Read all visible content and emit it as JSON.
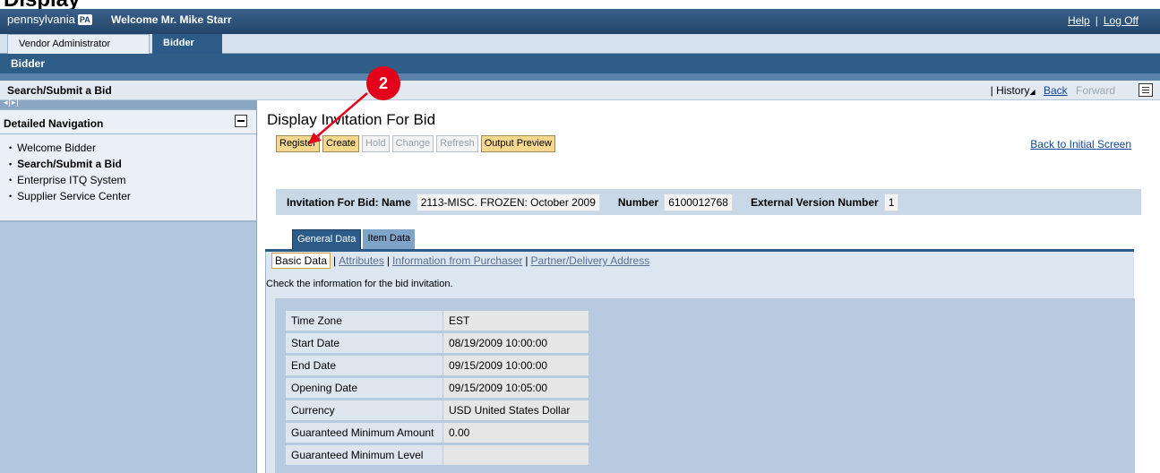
{
  "slide_title": "Display",
  "header": {
    "logo_text": "pennsylvania",
    "logo_badge": "PA",
    "welcome": "Welcome Mr. Mike Starr",
    "help_link": "Help",
    "logoff_link": "Log Off"
  },
  "tabs": {
    "vendor_admin": "Vendor Administrator",
    "bidder": "Bidder"
  },
  "subheader": "Bidder",
  "breadcrumb": {
    "current": "Search/Submit a Bid",
    "history_prefix": "| History",
    "back": "Back",
    "forward": "Forward"
  },
  "sidebar": {
    "title": "Detailed Navigation",
    "items": [
      {
        "label": "Welcome Bidder"
      },
      {
        "label": "Search/Submit a Bid"
      },
      {
        "label": "Enterprise ITQ System"
      },
      {
        "label": "Supplier Service Center"
      }
    ]
  },
  "main": {
    "title": "Display Invitation For Bid",
    "toolbar": {
      "register": "Register",
      "create": "Create",
      "hold": "Hold",
      "change": "Change",
      "refresh": "Refresh",
      "output_preview": "Output Preview"
    },
    "back_to_initial": "Back to Initial Screen",
    "ifb": {
      "name_label": "Invitation For Bid: Name",
      "name_value": "2113-MISC. FROZEN: October 2009",
      "number_label": "Number",
      "number_value": "6100012768",
      "ext_version_label": "External Version Number",
      "ext_version_value": "1"
    },
    "content_tabs": {
      "general": "General Data",
      "item": "Item Data"
    },
    "subtabs": {
      "basic": "Basic Data",
      "attributes": "Attributes",
      "info_purchaser": "Information from Purchaser",
      "partner_delivery": "Partner/Delivery Address"
    },
    "hint": "Check the information for the bid invitation.",
    "fields": [
      {
        "label": "Time Zone",
        "value": "EST"
      },
      {
        "label": "Start Date",
        "value": "08/19/2009  10:00:00"
      },
      {
        "label": "End Date",
        "value": "09/15/2009  10:00:00"
      },
      {
        "label": "Opening Date",
        "value": "09/15/2009 10:05:00"
      },
      {
        "label": "Currency",
        "value": "USD  United States Dollar"
      },
      {
        "label": "Guaranteed Minimum Amount",
        "value": "0.00"
      },
      {
        "label": "Guaranteed Minimum Level",
        "value": ""
      }
    ]
  },
  "annotation": {
    "marker": "2",
    "color": "#e4001b"
  }
}
